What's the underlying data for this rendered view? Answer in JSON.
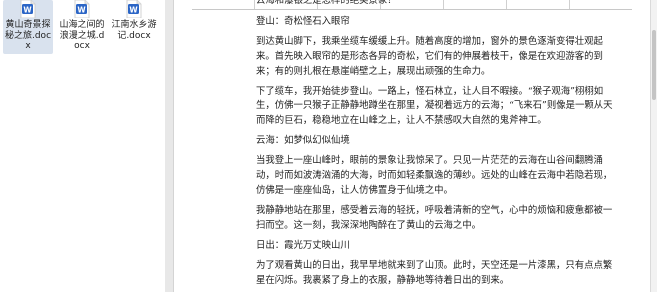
{
  "desktop": {
    "files": [
      {
        "label": "黄山奇景探秘之旅.docx",
        "selected": true
      },
      {
        "label": "山海之间的浪漫之城.docx",
        "selected": false
      },
      {
        "label": "江南水乡游记.docx",
        "selected": false
      }
    ],
    "file_icon": "word-doc-icon"
  },
  "document": {
    "partial_top_line": "云海和瀑银之是怎样的绝美景象？",
    "paragraphs": [
      "登山：奇松怪石入眼帘",
      "到达黄山脚下，我乘坐缆车缓缓上升。随着高度的增加，窗外的景色逐渐变得壮观起来。首先映入眼帘的是形态各异的奇松，它们有的伸展着枝干，像是在欢迎游客的到来；有的则扎根在悬崖峭壁之上，展现出顽强的生命力。",
      "下了缆车，我开始徒步登山。一路上，怪石林立，让人目不暇接。“猴子观海”栩栩如生，仿佛一只猴子正静静地蹲坐在那里，凝视着远方的云海；“飞来石”则像是一颗从天而降的巨石，稳稳地立在山峰之上，让人不禁感叹大自然的鬼斧神工。",
      "云海：如梦似幻似仙境",
      "当我登上一座山峰时，眼前的景象让我惊呆了。只见一片茫茫的云海在山谷间翻腾涌动，时而如波涛汹涌的大海，时而如轻柔飘逸的薄纱。远处的山峰在云海中若隐若现，仿佛是一座座仙岛，让人仿佛置身于仙境之中。",
      "我静静地站在那里，感受着云海的轻抚，呼吸着清新的空气，心中的烦恼和疲惫都被一扫而空。这一刻，我深深地陶醉在了黄山的云海之中。",
      "日出：霞光万丈映山川",
      "为了观看黄山的日出，我早早地就来到了山顶。此时，天空还是一片漆黑，只有点点繁星在闪烁。我裹紧了身上的衣服，静静地等待着日出的到来。"
    ]
  },
  "colors": {
    "selected_bg": "#d9e2ee",
    "word_blue": "#2b65c6",
    "text": "#222222"
  }
}
